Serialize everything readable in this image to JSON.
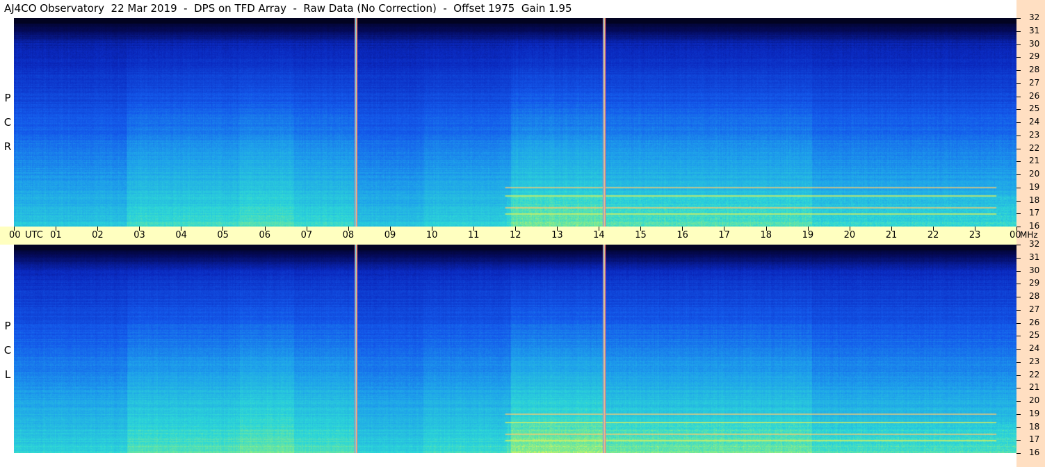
{
  "title": "AJ4CO Observatory  22 Mar 2019  -  DPS on TFD Array  -  Raw Data (No Correction)  -  Offset 1975  Gain 1.95",
  "panels": [
    {
      "id": "rcp",
      "letters": [
        "R",
        "C",
        "P"
      ]
    },
    {
      "id": "lcp",
      "letters": [
        "L",
        "C",
        "P"
      ]
    }
  ],
  "chart_data": {
    "type": "heatmap",
    "title": "AJ4CO Observatory  22 Mar 2019  -  DPS on TFD Array  -  Raw Data (No Correction)  -  Offset 1975  Gain 1.95",
    "x_axis": {
      "unit": "UTC",
      "range": [
        "00",
        "00"
      ],
      "tick_labels": [
        "00",
        "01",
        "02",
        "03",
        "04",
        "05",
        "06",
        "07",
        "08",
        "09",
        "10",
        "11",
        "12",
        "13",
        "14",
        "15",
        "16",
        "17",
        "18",
        "19",
        "20",
        "21",
        "22",
        "23",
        "00"
      ]
    },
    "y_axis": {
      "unit": "MHz",
      "range": [
        16,
        32
      ],
      "tick_labels": [
        "32",
        "31",
        "30",
        "29",
        "28",
        "27",
        "26",
        "25",
        "24",
        "23",
        "22",
        "21",
        "20",
        "19",
        "18",
        "17",
        "16"
      ]
    },
    "series": [
      {
        "name": "R C P"
      },
      {
        "name": "L C P"
      }
    ],
    "markers_utc_hours": [
      8.15,
      14.1
    ],
    "colors": {
      "low": "#00001a",
      "mid": "#1a3fe0",
      "high": "#3fd8d0",
      "peak": "#d8f060",
      "marker": "#ff6a8a"
    }
  }
}
